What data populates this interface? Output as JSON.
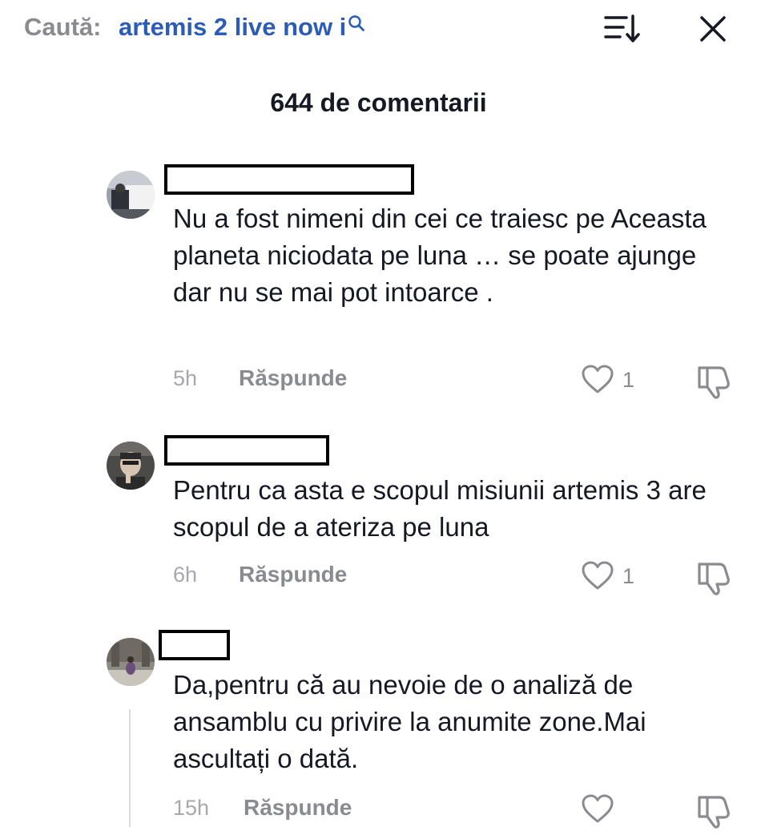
{
  "header": {
    "search_label": "Caută:",
    "search_query": "artemis 2 live now i",
    "search_icon": "search-icon",
    "sort_icon": "sort-icon",
    "close_icon": "close-icon"
  },
  "comment_count_title": "644 de comentarii",
  "comments": [
    {
      "text": "Nu a fost nimeni din cei ce traiesc pe Aceasta planeta niciodata pe luna … se poate ajunge dar nu se mai pot intoarce .",
      "time": "5h",
      "reply_label": "Răspunde",
      "likes": "1"
    },
    {
      "text": "Pentru ca asta e scopul misiunii artemis 3 are scopul de a ateriza pe luna",
      "time": "6h",
      "reply_label": "Răspunde",
      "likes": "1"
    },
    {
      "text": "Da,pentru că au nevoie de o analiză de ansamblu cu privire la anumite zone.Mai ascultați o dată.",
      "time": "15h",
      "reply_label": "Răspunde",
      "likes": ""
    }
  ],
  "colors": {
    "query_blue": "#2b5db8",
    "muted_gray": "#8a8b91",
    "text_dark": "#161823"
  }
}
